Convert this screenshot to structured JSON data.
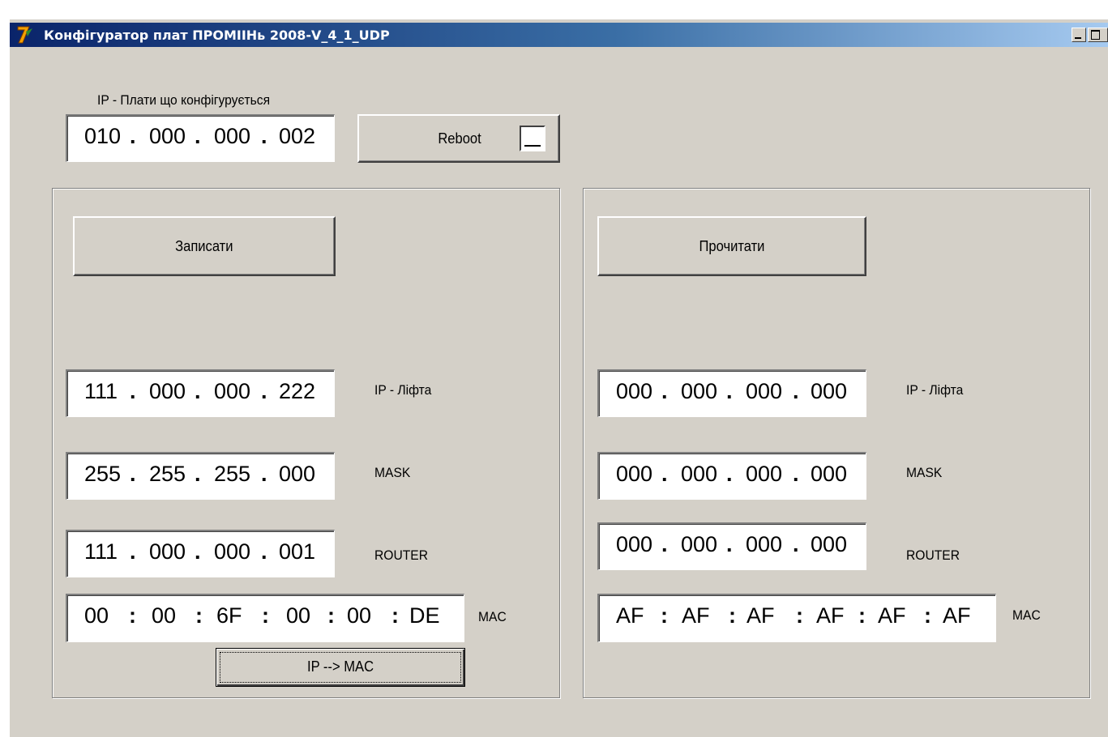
{
  "window": {
    "title": "Конфігуратор плат ПРОМІІНь 2008-V_4_1_UDP"
  },
  "board_ip": {
    "label": "IP - Плати що конфігурується",
    "octets": [
      "010",
      "000",
      "000",
      "002"
    ]
  },
  "reboot": {
    "label": "Reboot",
    "checked": false
  },
  "write_panel": {
    "button_label": "Записати",
    "ip": {
      "label": "IP - Ліфта",
      "octets": [
        "111",
        "000",
        "000",
        "222"
      ]
    },
    "mask": {
      "label": "MASK",
      "octets": [
        "255",
        "255",
        "255",
        "000"
      ]
    },
    "router": {
      "label": "ROUTER",
      "octets": [
        "111",
        "000",
        "000",
        "001"
      ]
    },
    "mac": {
      "label": "MAC",
      "bytes": [
        "00",
        "00",
        "6F",
        "00",
        "00",
        "DE"
      ]
    },
    "ip_to_mac_label": "IP --> MAC"
  },
  "read_panel": {
    "button_label": "Прочитати",
    "ip": {
      "label": "IP - Ліфта",
      "octets": [
        "000",
        "000",
        "000",
        "000"
      ]
    },
    "mask": {
      "label": "MASK",
      "octets": [
        "000",
        "000",
        "000",
        "000"
      ]
    },
    "router": {
      "label": "ROUTER",
      "octets": [
        "000",
        "000",
        "000",
        "000"
      ]
    },
    "mac": {
      "label": "MAC",
      "bytes": [
        "AF",
        "AF",
        "AF",
        "AF",
        "AF",
        "AF"
      ]
    }
  },
  "separators": {
    "ip": ".",
    "mac": ":"
  },
  "colors": {
    "window_face": "#d4d0c8",
    "titlebar_start": "#0a246a",
    "titlebar_end": "#a6caf0"
  }
}
